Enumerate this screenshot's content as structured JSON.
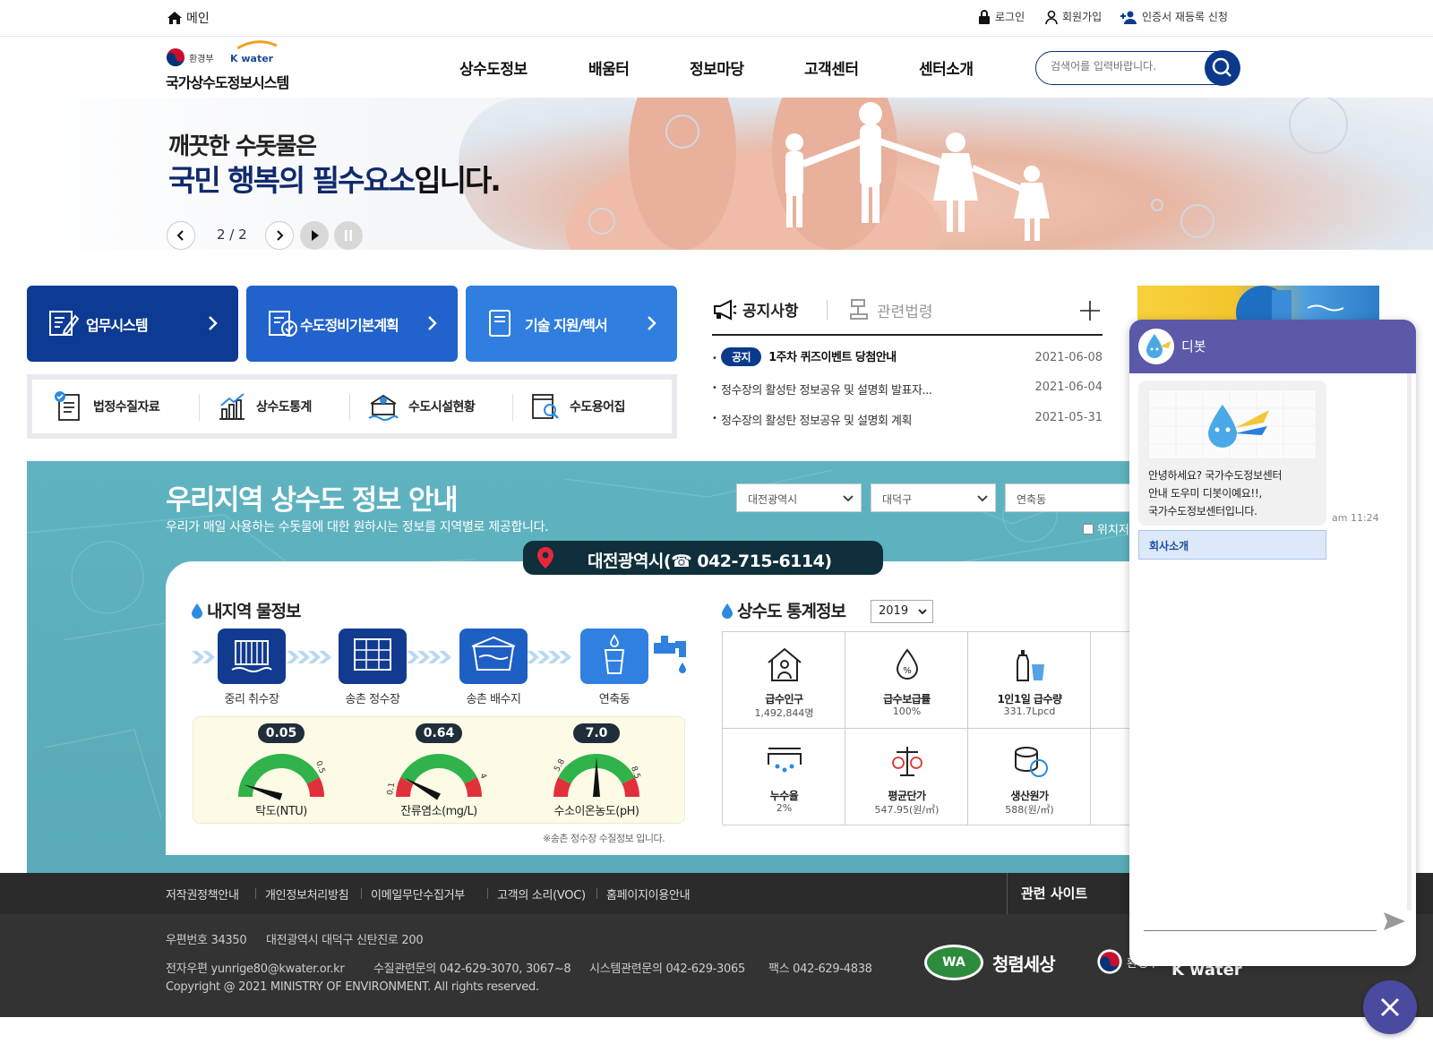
{
  "topbar": {
    "home_label": "메인",
    "login": "로그인",
    "signup": "회원가입",
    "cert": "인증서 재등록 신청"
  },
  "header": {
    "logo_moe": "환경부",
    "logo_kwater": "K water",
    "logo_title": "국가상수도정보시스템",
    "nav": [
      "상수도정보",
      "배움터",
      "정보마당",
      "고객센터",
      "센터소개"
    ],
    "search_placeholder": "검색어를 입력바랍니다."
  },
  "hero": {
    "line1": "깨끗한 수돗물은",
    "line2_highlight": "국민 행복의 필수요소",
    "line2_rest": "입니다.",
    "pager": "2 / 2"
  },
  "tiles": [
    "업무시스템",
    "수도정비기본계획",
    "기술 지원/백서"
  ],
  "tile_colors": [
    "#0d3a93",
    "#2162cc",
    "#2f7ee0"
  ],
  "sub_links": [
    "법정수질자료",
    "상수도통계",
    "수도시설현황",
    "수도용어집"
  ],
  "notice": {
    "tab_active": "공지사항",
    "tab_inactive": "관련법령",
    "badge": "공지",
    "items": [
      {
        "title": "1주차 퀴즈이벤트 당첨안내",
        "date": "2021-06-08"
      },
      {
        "title": "정수장의 활성탄 정보공유 및 설명회 발표자...",
        "date": "2021-06-04"
      },
      {
        "title": "정수장의 활성탄 정보공유 및 설명회 계획",
        "date": "2021-05-31"
      }
    ]
  },
  "region": {
    "title": "우리지역 상수도 정보 안내",
    "subtitle": "우리가 매일 사용하는 수돗물에 대한 원하시는 정보를 지역별로 제공합니다.",
    "selects": [
      "대전광역시",
      "대덕구",
      "연축동"
    ],
    "location_check": "위치저",
    "location_pill": "대전광역시(☎ 042-715-6114)"
  },
  "water_info": {
    "title": "내지역 물정보",
    "steps": [
      "중리 취수장",
      "송촌 정수장",
      "송촌 배수지",
      "연축동"
    ],
    "gauges": [
      {
        "label": "탁도(NTU)",
        "value": "0.05",
        "min": "0",
        "max": "0.5",
        "level": 0.1
      },
      {
        "label": "잔류염소(mg/L)",
        "value": "0.64",
        "min": "0.1",
        "max": "4",
        "level": 0.16
      },
      {
        "label": "수소이온농도(pH)",
        "value": "7.0",
        "min": "5.8",
        "max": "8.5",
        "level": 0.5
      }
    ],
    "note": "※송촌 정수장 수질정보 입니다."
  },
  "stats": {
    "title": "상수도 통계정보",
    "year": "2019",
    "cells": [
      {
        "name": "급수인구",
        "value": "1,492,844명",
        "icon": "house-person-icon"
      },
      {
        "name": "급수보급률",
        "value": "100%",
        "icon": "drop-percent-icon"
      },
      {
        "name": "1인1일 급수량",
        "value": "331.7Lpcd",
        "icon": "bottle-cup-icon"
      },
      {
        "name": "누수율",
        "value": "2%",
        "icon": "leak-pipe-icon"
      },
      {
        "name": "평균단가",
        "value": "547.95(원/㎥)",
        "icon": "scale-won-icon"
      },
      {
        "name": "생산원가",
        "value": "588(원/㎥)",
        "icon": "coins-won-icon"
      }
    ]
  },
  "footer": {
    "links": [
      "저작권정책안내",
      "개인정보처리방침",
      "이메일무단수집거부",
      "고객의 소리(VOC)",
      "홈페이지이용안내"
    ],
    "related": "관련 사이트",
    "postcode": "우편번호 34350",
    "address": "대전광역시 대덕구 신탄진로 200",
    "email": "전자우편 yunrige80@kwater.or.kr",
    "contact1": "수질관련문의 042-629-3070, 3067~8",
    "contact2": "시스템관련문의 042-629-3065",
    "fax": "팩스 042-629-4838",
    "copyright": "Copyright @ 2021 MINISTRY OF ENVIRONMENT. All rights reserved.",
    "logo_wa": "WA",
    "logo_cheong": "청렴세상",
    "logo_moe": "환경부",
    "logo_kwater": "K water"
  },
  "chatbot": {
    "name": "디봇",
    "message_line1": "안녕하세요? 국가수도정보센터",
    "message_line2": "안내 도우미 디봇이예요!!,",
    "message_line3": "국가수도정보센터입니다.",
    "time": "am 11:24",
    "button": "회사소개"
  }
}
